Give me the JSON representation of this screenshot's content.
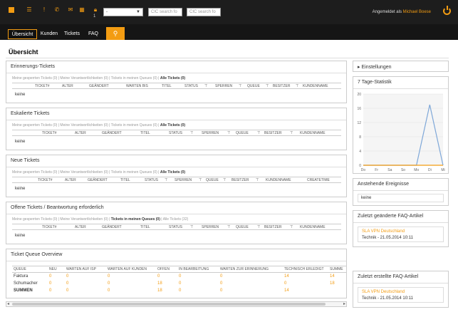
{
  "header": {
    "badge_count": "1",
    "select_value": "-",
    "search_placeholder_1": "CIC search fo",
    "search_placeholder_2": "CIC search fo",
    "logged_in_prefix": "Angemeldet als",
    "user_name": "Michael Boese"
  },
  "nav": {
    "tabs": [
      "Übersicht",
      "Kunden",
      "Tickets",
      "FAQ"
    ]
  },
  "page": {
    "title": "Übersicht"
  },
  "panels": [
    {
      "title": "Erinnerungs-Tickets",
      "filters_pre": "Meine gesperrten Tickets (0) | Meine Verantwortlichkeiten (0) | Tickets in meinen Queues (0) |",
      "filters_bold": "Alle Tickets (0)",
      "filters_post": "",
      "columns": [
        "TICKET#",
        "ALTER",
        "GEÄNDERT",
        "WARTEN BIS",
        "TITEL",
        "STATUS",
        "SPERREN",
        "QUEUE",
        "BESITZER",
        "KUNDENNAME"
      ],
      "empty": "keine"
    },
    {
      "title": "Eskalierte Tickets",
      "filters_pre": "Meine gesperrten Tickets (0) | Meine Verantwortlichkeiten (0) | Tickets in meinen Queues (0) |",
      "filters_bold": "Alle Tickets (0)",
      "filters_post": "",
      "columns": [
        "TICKET#",
        "ALTER",
        "GEÄNDERT",
        "TITEL",
        "STATUS",
        "SPERREN",
        "QUEUE",
        "BESITZER",
        "KUNDENNAME"
      ],
      "empty": "keine"
    },
    {
      "title": "Neue Tickets",
      "filters_pre": "Meine gesperrten Tickets (0) | Meine Verantwortlichkeiten (0) | Tickets in meinen Queues (0) |",
      "filters_bold": "Alle Tickets (0)",
      "filters_post": "",
      "columns": [
        "TICKET#",
        "ALTER",
        "GEÄNDERT",
        "TITEL",
        "STATUS",
        "SPERREN",
        "QUEUE",
        "BESITZER",
        "KUNDENNAME",
        "CREATETIME"
      ],
      "empty": "keine"
    },
    {
      "title": "Offene Tickets / Beantwortung erforderlich",
      "filters_pre": "Meine gesperrten Tickets (0) | Meine Verantwortlichkeiten (0) |",
      "filters_bold": "Tickets in meinen Queues (0)",
      "filters_post": "| Alle Tickets (32)",
      "columns": [
        "TICKET#",
        "ALTER",
        "GEÄNDERT",
        "TITEL",
        "STATUS",
        "SPERREN",
        "QUEUE",
        "BESITZER",
        "KUNDENNAME"
      ],
      "empty": "keine"
    }
  ],
  "queue_overview": {
    "title": "Ticket Queue Overview",
    "columns": [
      "QUEUE",
      "NEU",
      "WARTEN AUF ISP",
      "WARTEN AUF KUNDEN",
      "OFFEN",
      "IN BEARBEITUNG",
      "WARTEN ZUR ERINNERUNG",
      "TECHNISCH ERLEDIGT",
      "SUMME"
    ],
    "rows": [
      [
        "Faktura",
        "0",
        "0",
        "0",
        "0",
        "0",
        "0",
        "14",
        "14"
      ],
      [
        "Schumacher",
        "0",
        "0",
        "0",
        "18",
        "0",
        "0",
        "0",
        "18"
      ],
      [
        "SUMMEN",
        "0",
        "0",
        "0",
        "18",
        "0",
        "0",
        "14",
        ""
      ]
    ]
  },
  "sidebar": {
    "settings": "Einstellungen",
    "stats_title": "7 Tage-Statistik",
    "events_title": "Anstehende Ereignisse",
    "events_value": "keine",
    "faq_changed_title": "Zuletzt geänderte FAQ-Artikel",
    "faq_changed_item": "SLA VPN Deutschland",
    "faq_changed_meta": "Technik - 21.05.2014 10:11",
    "faq_created_title": "Zuletzt erstellte FAQ-Artikel",
    "faq_created_item": "SLA VPN Deutschland",
    "faq_created_meta": "Technik - 21.05.2014 10:11"
  },
  "chart_data": {
    "type": "line",
    "categories": [
      "Do",
      "Fr",
      "Sa",
      "So",
      "Mo",
      "Di",
      "Mi"
    ],
    "ylim": [
      0,
      20
    ],
    "yticks": [
      "0",
      "4",
      "8",
      "12",
      "16",
      "20"
    ],
    "grid": true,
    "series": [
      {
        "values": [
          0,
          0,
          0,
          0,
          0,
          17,
          0
        ],
        "color": "#7ea7d8"
      },
      {
        "values": [
          0,
          0,
          0,
          0,
          0,
          0,
          0
        ],
        "color": "#f39c12"
      }
    ]
  },
  "colors": {
    "accent": "#f39c12",
    "topbar": "#1d1d1d"
  }
}
